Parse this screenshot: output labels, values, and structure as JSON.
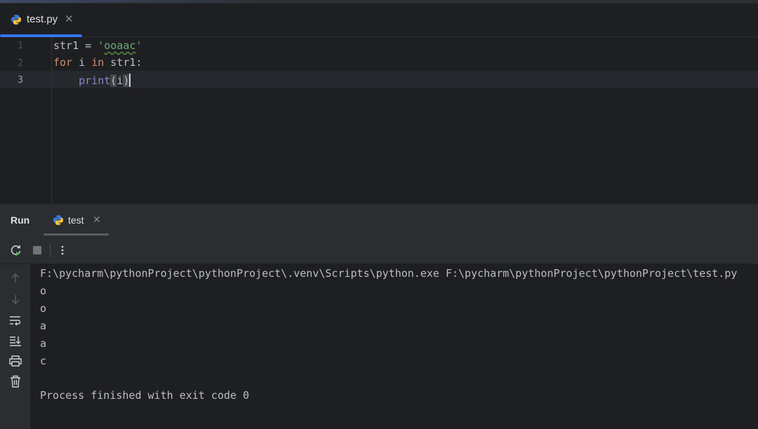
{
  "editor_tab": {
    "label": "test.py",
    "close": "✕",
    "icon": "python-file-icon"
  },
  "editor": {
    "line_numbers": [
      "1",
      "2",
      "3"
    ],
    "lines": [
      {
        "var": "str1",
        "op": " = ",
        "q1": "'",
        "literal": "ooaac",
        "q2": "'"
      },
      {
        "kw1": "for",
        "mid1": " i ",
        "kw2": "in",
        "mid2": " str1:"
      },
      {
        "indent": "    ",
        "fn": "print",
        "open": "(",
        "arg": "i",
        "close": ")"
      }
    ]
  },
  "run_panel": {
    "title": "Run",
    "tab": {
      "label": "test",
      "close": "✕",
      "icon": "python-file-icon"
    },
    "toolbar": [
      "rerun-icon",
      "stop-icon",
      "more-options-icon"
    ],
    "side_tools": [
      "up-arrow-icon",
      "down-arrow-icon",
      "soft-wrap-icon",
      "scroll-to-end-icon",
      "print-icon",
      "trash-icon"
    ],
    "console_lines": [
      "F:\\pycharm\\pythonProject\\pythonProject\\.venv\\Scripts\\python.exe F:\\pycharm\\pythonProject\\pythonProject\\test.py",
      "o",
      "o",
      "a",
      "a",
      "c",
      "",
      "Process finished with exit code 0"
    ]
  },
  "colors": {
    "accent": "#3574f0",
    "keyword": "#cf8e6d",
    "string": "#6aab73",
    "builtin": "#8888c6",
    "bg": "#1e1f22",
    "panel": "#2b2d30"
  }
}
